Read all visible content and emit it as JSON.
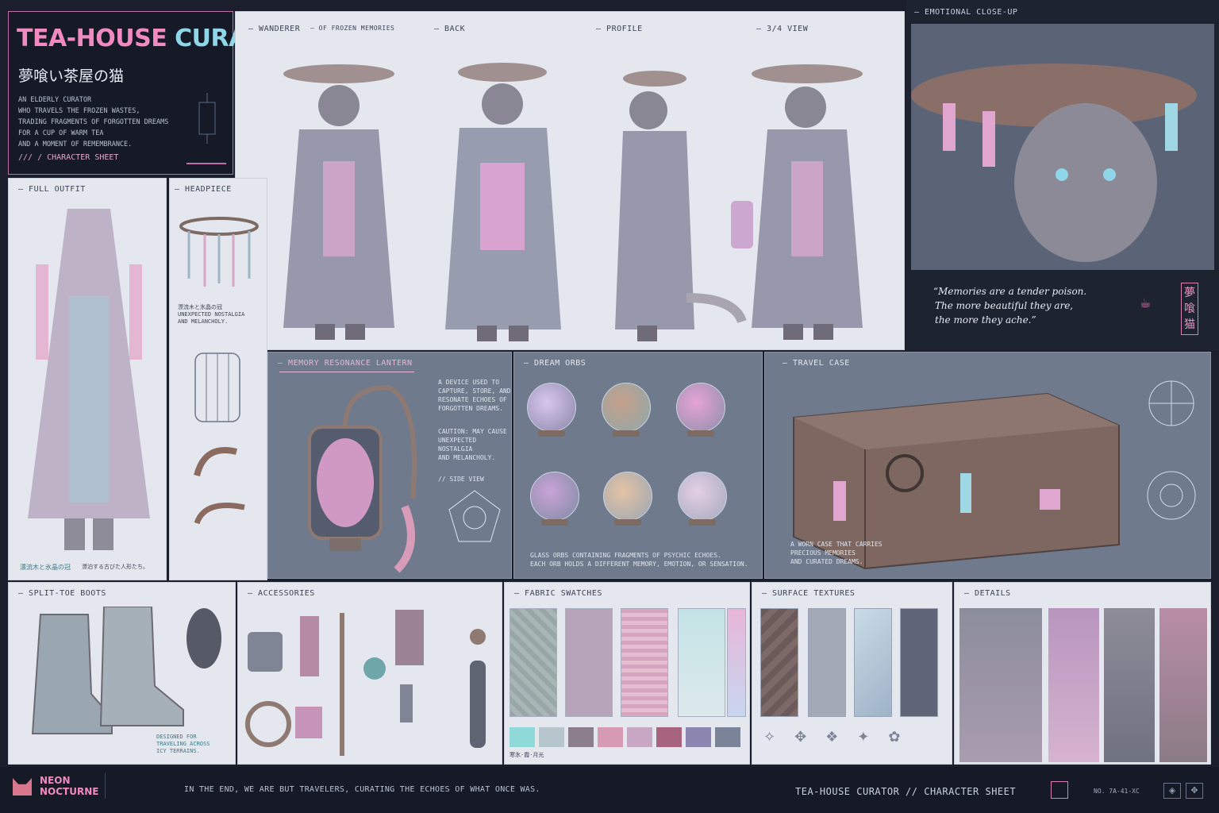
{
  "header": {
    "title_part1": "TEA-HOUSE",
    "title_part2": "CURATOR",
    "title_jp": "夢喰い茶屋の猫",
    "description_lines": [
      "AN ELDERLY CURATOR",
      "WHO TRAVELS THE FROZEN WASTES,",
      "TRADING FRAGMENTS OF FORGOTTEN DREAMS",
      "FOR A CUP OF WARM TEA",
      "AND A MOMENT OF REMEMBRANCE."
    ],
    "sheet_label": "/// / CHARACTER SHEET"
  },
  "views": {
    "wanderer": "WANDERER",
    "wanderer_sub": "OF FROZEN MEMORIES",
    "back": "BACK",
    "profile": "PROFILE",
    "three_quarter": "3/4 VIEW"
  },
  "closeup": {
    "label": "EMOTIONAL CLOSE-UP",
    "quote_lines": [
      "“Memories are a tender poison.",
      "The more beautiful they are,",
      "the more they ache.”"
    ],
    "seal": "夢喰猫"
  },
  "full_outfit": {
    "label": "FULL OUTFIT",
    "caption_jp": "漂流木と氷晶の冠",
    "caption_note": "漂泊する古びた人形たち。"
  },
  "headpiece": {
    "label": "HEADPIECE",
    "note_lines": [
      "漂流木と氷晶の冠",
      "UNEXPECTED NOSTALGIA",
      "AND MELANCHOLY."
    ]
  },
  "lantern": {
    "label": "MEMORY RESONANCE LANTERN",
    "desc_lines": [
      "A DEVICE USED TO",
      "CAPTURE, STORE, AND",
      "RESONATE ECHOES OF",
      "FORGOTTEN DREAMS."
    ],
    "caution_lines": [
      "CAUTION: MAY CAUSE",
      "UNEXPECTED NOSTALGIA",
      "AND MELANCHOLY."
    ],
    "side_view": "// SIDE VIEW"
  },
  "orbs": {
    "label": "DREAM ORBS",
    "caption_lines": [
      "GLASS ORBS CONTAINING FRAGMENTS OF PSYCHIC ECHOES.",
      "EACH ORB HOLDS A DIFFERENT MEMORY, EMOTION, OR SENSATION."
    ]
  },
  "travel_case": {
    "label": "TRAVEL CASE",
    "caption_lines": [
      "A WORN CASE THAT CARRIES",
      "PRECIOUS MEMORIES",
      "AND CURATED DREAMS."
    ]
  },
  "boots": {
    "label": "SPLIT-TOE BOOTS",
    "caption_lines": [
      "DESIGNED FOR",
      "TRAVELING ACROSS",
      "ICY TERRAINS."
    ]
  },
  "accessories": {
    "label": "ACCESSORIES"
  },
  "fabric": {
    "label": "FABRIC SWATCHES",
    "note": "寒氷·霞·月光",
    "palette": [
      "#8fd9d8",
      "#b6c6cc",
      "#8a7f8a",
      "#d79ab4",
      "#c7a7c4",
      "#a7647e",
      "#8d86b0",
      "#7b8398"
    ]
  },
  "textures": {
    "label": "SURFACE TEXTURES"
  },
  "details": {
    "label": "DETAILS"
  },
  "footer": {
    "brand_line1": "NEON",
    "brand_line2": "NOCTURNE",
    "tagline": "IN THE END, WE ARE BUT TRAVELERS, CURATING THE ECHOES OF WHAT ONCE WAS.",
    "sheet_title": "TEA-HOUSE CURATOR // CHARACTER SHEET",
    "sheet_no": "NO. 7A-41-XC"
  },
  "colors": {
    "accent_pink": "#f08ac0",
    "accent_cyan": "#8fd6e8",
    "background": "#1b1f2c"
  }
}
